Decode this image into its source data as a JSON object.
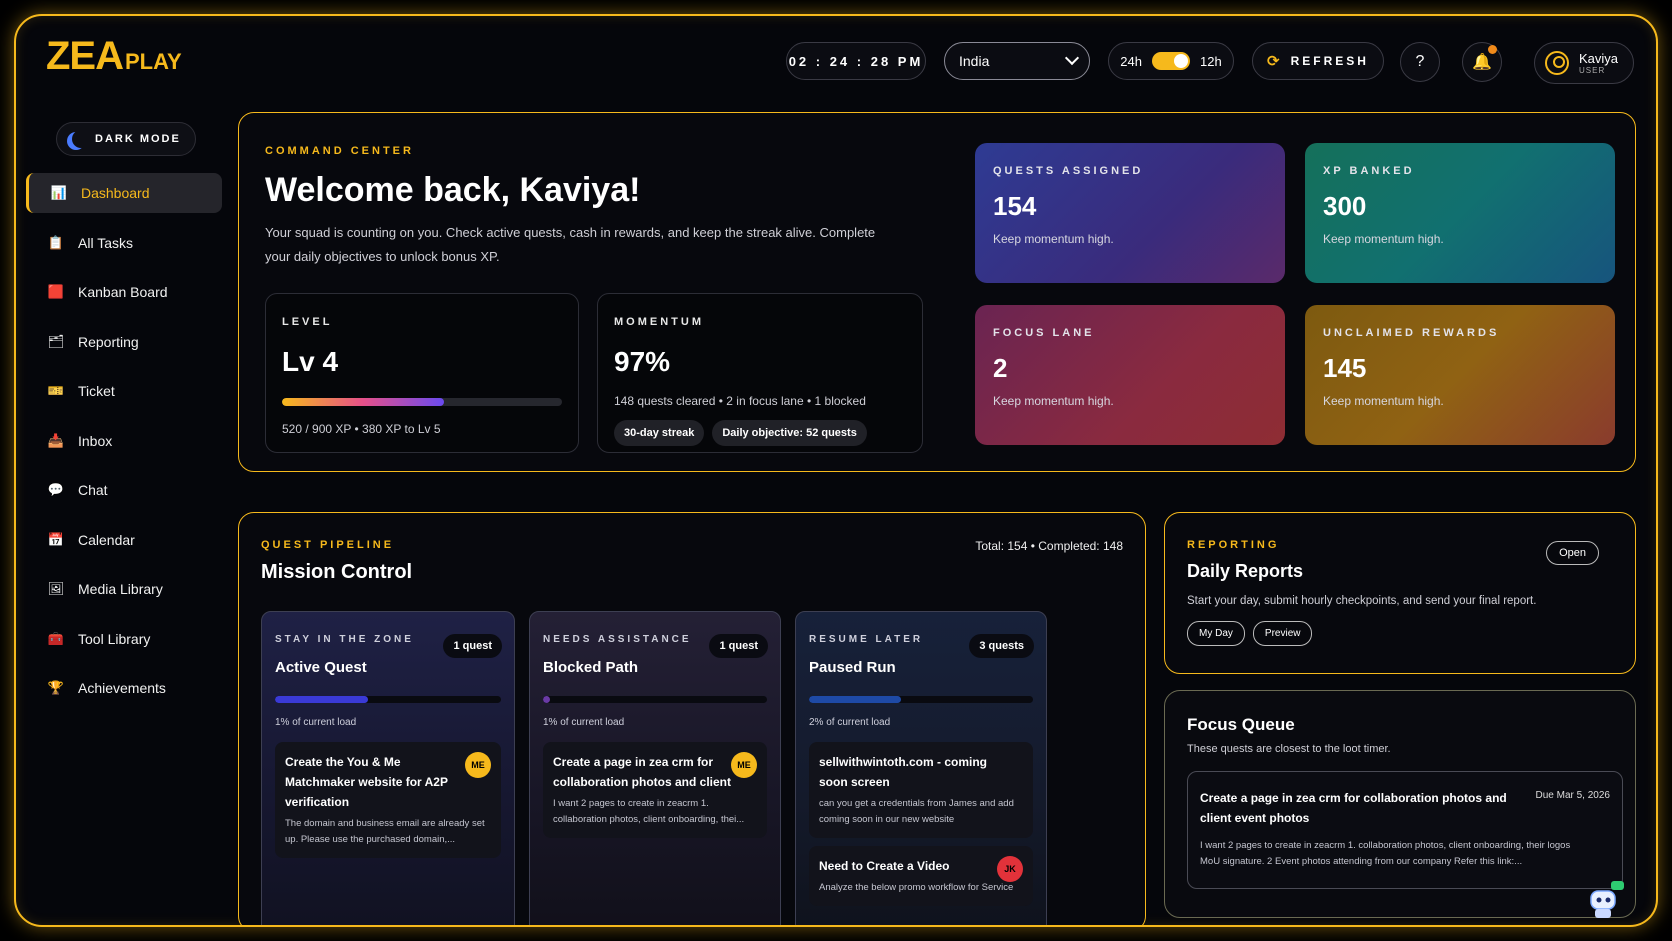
{
  "brand": {
    "logo_main": "ZEA",
    "logo_sub": "PLAY",
    "accent": "#f6b91c"
  },
  "topbar": {
    "clock": "02 : 24 : 28  PM",
    "country": "India",
    "format_left": "24h",
    "format_right": "12h",
    "refresh_label": "REFRESH",
    "help_icon": "help-circle-icon",
    "bell_icon": "bell-icon",
    "user_name": "Kaviya",
    "user_role": "USER"
  },
  "sidebar": {
    "dark_mode_label": "DARK MODE",
    "items": [
      {
        "label": "Dashboard",
        "icon": "📊",
        "active": true
      },
      {
        "label": "All Tasks",
        "icon": "📋"
      },
      {
        "label": "Kanban Board",
        "icon": "🟥"
      },
      {
        "label": "Reporting",
        "icon": "🗂"
      },
      {
        "label": "Ticket",
        "icon": "🎫"
      },
      {
        "label": "Inbox",
        "icon": "📥"
      },
      {
        "label": "Chat",
        "icon": "💬"
      },
      {
        "label": "Calendar",
        "icon": "📅"
      },
      {
        "label": "Media Library",
        "icon": "🖼"
      },
      {
        "label": "Tool Library",
        "icon": "🧰"
      },
      {
        "label": "Achievements",
        "icon": "🏆"
      }
    ]
  },
  "command": {
    "eyebrow": "COMMAND CENTER",
    "welcome": "Welcome back, Kaviya!",
    "intro": "Your squad is counting on you. Check active quests, cash in rewards, and keep the streak alive. Complete your daily objectives to unlock bonus XP.",
    "level": {
      "label": "LEVEL",
      "value": "Lv 4",
      "progress": 0.58,
      "sub": "520 / 900 XP • 380 XP to Lv 5"
    },
    "momentum": {
      "label": "MOMENTUM",
      "value": "97%",
      "sub": "148 quests cleared • 2 in focus lane • 1 blocked",
      "chip1": "30-day streak",
      "chip2": "Daily objective: 52 quests"
    },
    "kpis": [
      {
        "label": "QUESTS ASSIGNED",
        "value": "154",
        "note": "Keep momentum high."
      },
      {
        "label": "XP BANKED",
        "value": "300",
        "note": "Keep momentum high."
      },
      {
        "label": "FOCUS LANE",
        "value": "2",
        "note": "Keep momentum high."
      },
      {
        "label": "UNCLAIMED REWARDS",
        "value": "145",
        "note": "Keep momentum high."
      }
    ]
  },
  "pipeline": {
    "eyebrow": "QUEST PIPELINE",
    "title": "Mission Control",
    "total": "Total: 154 • Completed: 148",
    "lanes": [
      {
        "kicker": "STAY IN THE ZONE",
        "title": "Active Quest",
        "count": "1 quest",
        "load": "1% of current load",
        "progress": 0.41,
        "color": "#3a3ad6",
        "tasks": [
          {
            "title": "Create the You & Me Matchmaker website for A2P verification",
            "desc": "The domain and business email are already set up. Please use the purchased domain,...",
            "badge": "ME"
          }
        ]
      },
      {
        "kicker": "NEEDS ASSISTANCE",
        "title": "Blocked Path",
        "count": "1 quest",
        "load": "1% of current load",
        "progress": 0.03,
        "color": "#6a3aa6",
        "tasks": [
          {
            "title": "Create a page in zea crm for collaboration photos and client",
            "desc": "I want 2 pages to create in zeacrm 1. collaboration photos, client onboarding, thei...",
            "badge": "ME"
          }
        ]
      },
      {
        "kicker": "RESUME LATER",
        "title": "Paused Run",
        "count": "3 quests",
        "load": "2% of current load",
        "progress": 0.41,
        "color": "#1e4aa6",
        "tasks": [
          {
            "title": "sellwithwintoth.com - coming soon screen",
            "desc": "can you get a credentials from James and add coming soon in our new website"
          },
          {
            "title": "Need to Create a Video",
            "desc": "Analyze the below promo workflow for Service",
            "badge": "JK"
          }
        ]
      }
    ]
  },
  "reporting": {
    "eyebrow": "REPORTING",
    "title": "Daily Reports",
    "open_label": "Open",
    "desc": "Start your day, submit hourly checkpoints, and send your final report.",
    "btn1": "My Day",
    "btn2": "Preview"
  },
  "focus": {
    "title": "Focus Queue",
    "desc": "These quests are closest to the loot timer.",
    "card_title": "Create a page in zea crm for collaboration photos and client event photos",
    "card_due": "Due Mar 5, 2026",
    "card_desc": "I want 2 pages to create in zeacrm 1. collaboration photos, client onboarding, their logos MoU signature. 2 Event photos attending from our company Refer this link:..."
  }
}
